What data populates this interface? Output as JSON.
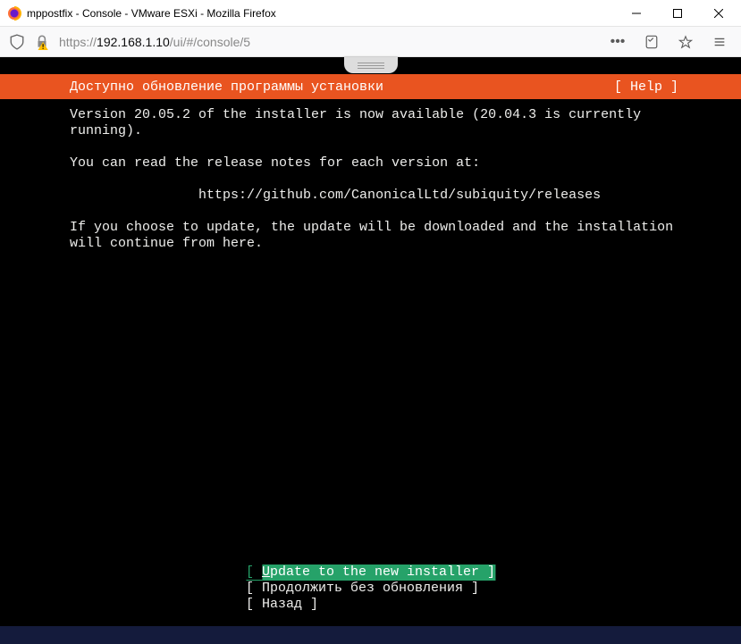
{
  "window": {
    "title": "mppostfix - Console - VMware ESXi - Mozilla Firefox"
  },
  "url": {
    "scheme": "https://",
    "host": "192.168.1.10",
    "path": "/ui/#/console/5"
  },
  "header": {
    "title": "Доступно обновление программы установки",
    "help": "[ Help ]"
  },
  "body": {
    "line1": "Version 20.05.2 of the installer is now available (20.04.3 is currently running).",
    "line2": "You can read the release notes for each version at:",
    "link": "https://github.com/CanonicalLtd/subiquity/releases",
    "line3": "If you choose to update, the update will be downloaded and the installation will continue from here."
  },
  "menu": {
    "opt1_pre": "[ ",
    "opt1_u": "U",
    "opt1_rest": "pdate to the new installer ]",
    "opt2": "[ Продолжить без обновления   ]",
    "opt3": "[ Назад                       ]"
  }
}
